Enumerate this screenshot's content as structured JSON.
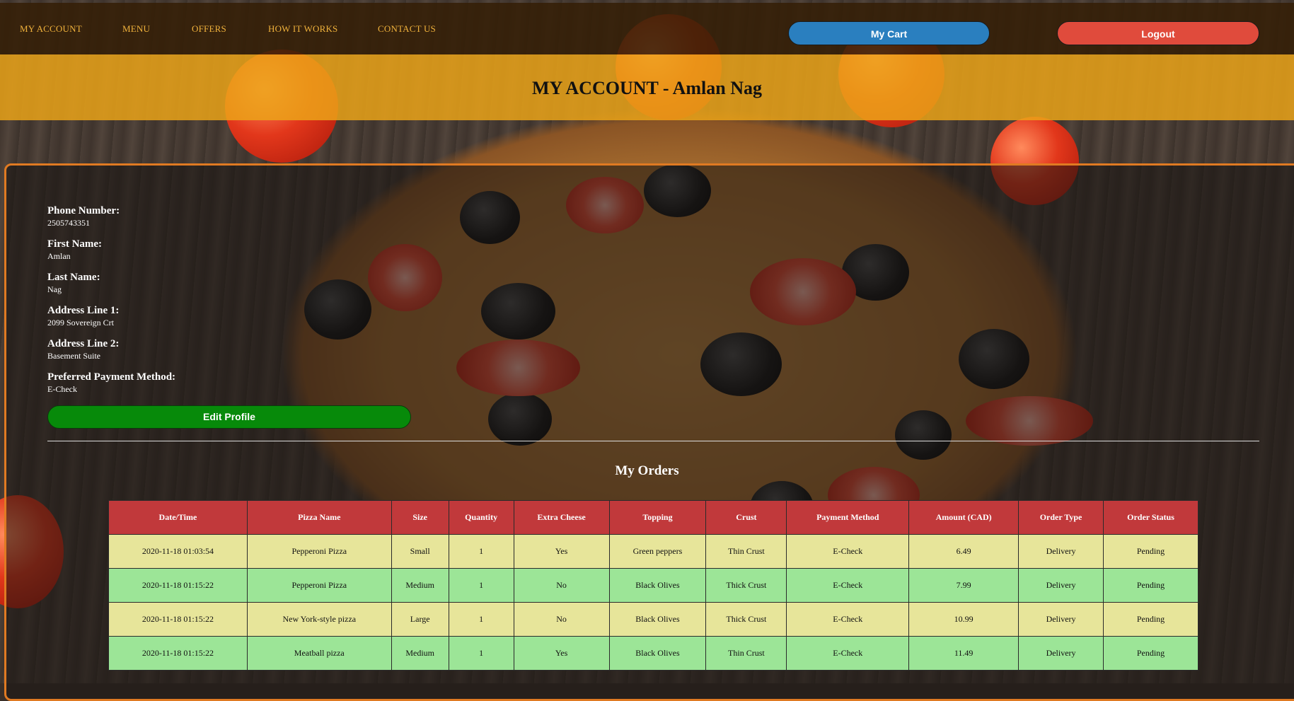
{
  "nav": {
    "items": [
      "MY ACCOUNT",
      "MENU",
      "OFFERS",
      "HOW IT WORKS",
      "CONTACT US"
    ],
    "cart_label": "My Cart",
    "logout_label": "Logout"
  },
  "page": {
    "title": "MY ACCOUNT - Amlan Nag"
  },
  "profile": {
    "phone_label": "Phone Number:",
    "phone_value": "2505743351",
    "first_name_label": "First Name:",
    "first_name_value": "Amlan",
    "last_name_label": "Last Name:",
    "last_name_value": "Nag",
    "address1_label": "Address Line 1:",
    "address1_value": "2099 Sovereign Crt",
    "address2_label": "Address Line 2:",
    "address2_value": "Basement Suite",
    "payment_label": "Preferred Payment Method:",
    "payment_value": "E-Check",
    "edit_label": "Edit Profile"
  },
  "orders": {
    "title": "My Orders",
    "headers": [
      "Date/Time",
      "Pizza Name",
      "Size",
      "Quantity",
      "Extra Cheese",
      "Topping",
      "Crust",
      "Payment Method",
      "Amount (CAD)",
      "Order Type",
      "Order Status"
    ],
    "rows": [
      [
        "2020-11-18 01:03:54",
        "Pepperoni Pizza",
        "Small",
        "1",
        "Yes",
        "Green peppers",
        "Thin Crust",
        "E-Check",
        "6.49",
        "Delivery",
        "Pending"
      ],
      [
        "2020-11-18 01:15:22",
        "Pepperoni Pizza",
        "Medium",
        "1",
        "No",
        "Black Olives",
        "Thick Crust",
        "E-Check",
        "7.99",
        "Delivery",
        "Pending"
      ],
      [
        "2020-11-18 01:15:22",
        "New York-style pizza",
        "Large",
        "1",
        "No",
        "Black Olives",
        "Thick Crust",
        "E-Check",
        "10.99",
        "Delivery",
        "Pending"
      ],
      [
        "2020-11-18 01:15:22",
        "Meatball pizza",
        "Medium",
        "1",
        "Yes",
        "Black Olives",
        "Thin Crust",
        "E-Check",
        "11.49",
        "Delivery",
        "Pending"
      ]
    ]
  },
  "colors": {
    "nav_text": "#f0b23c",
    "cart_button": "#2a7fbf",
    "logout_button": "#e04b3c",
    "edit_button": "#078a0a",
    "table_header": "#c1393b",
    "row_yellow": "#e7e59a",
    "row_green": "#9ce597",
    "panel_border": "#e07a22"
  }
}
